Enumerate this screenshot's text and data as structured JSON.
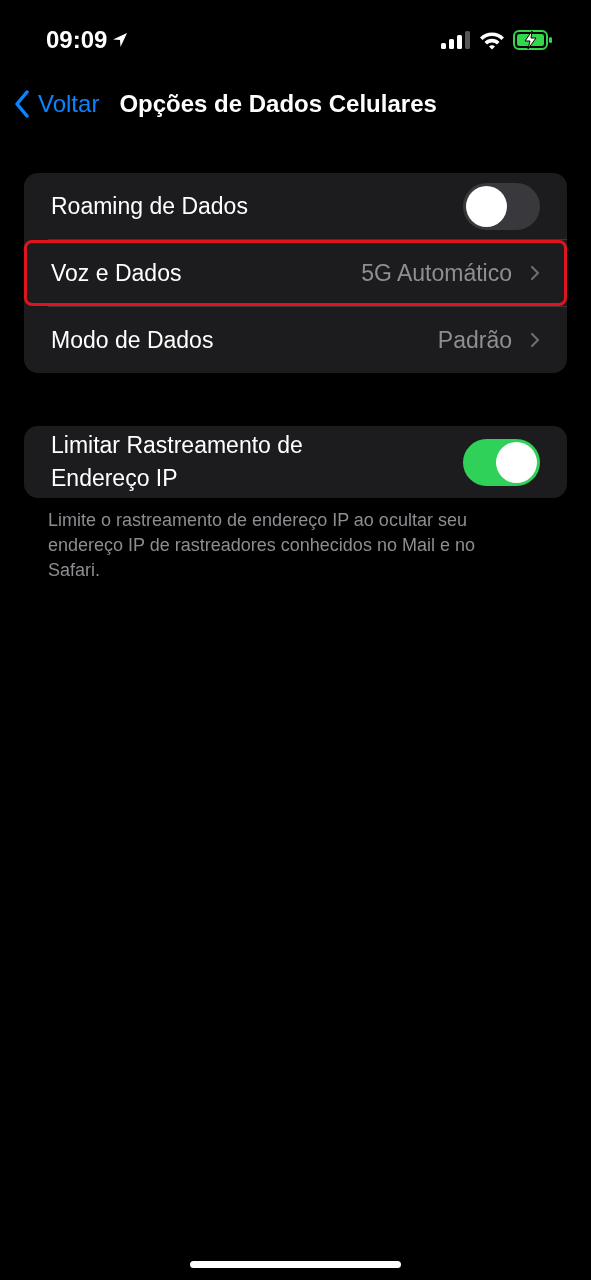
{
  "status_bar": {
    "time": "09:09",
    "charging": true
  },
  "nav": {
    "back": "Voltar",
    "title": "Opções de Dados Celulares"
  },
  "groups": [
    {
      "rows": [
        {
          "kind": "toggle",
          "label": "Roaming de Dados",
          "on": false,
          "highlighted": false
        },
        {
          "kind": "link",
          "label": "Voz e Dados",
          "value": "5G Automático",
          "highlighted": true
        },
        {
          "kind": "link",
          "label": "Modo de Dados",
          "value": "Padrão",
          "highlighted": false
        }
      ]
    },
    {
      "rows": [
        {
          "kind": "toggle",
          "label": "Limitar Rastreamento de Endereço IP",
          "on": true,
          "highlighted": false
        }
      ],
      "footer": "Limite o rastreamento de endereço IP ao ocultar seu endereço IP de rastreadores conhecidos no Mail e no Safari."
    }
  ]
}
